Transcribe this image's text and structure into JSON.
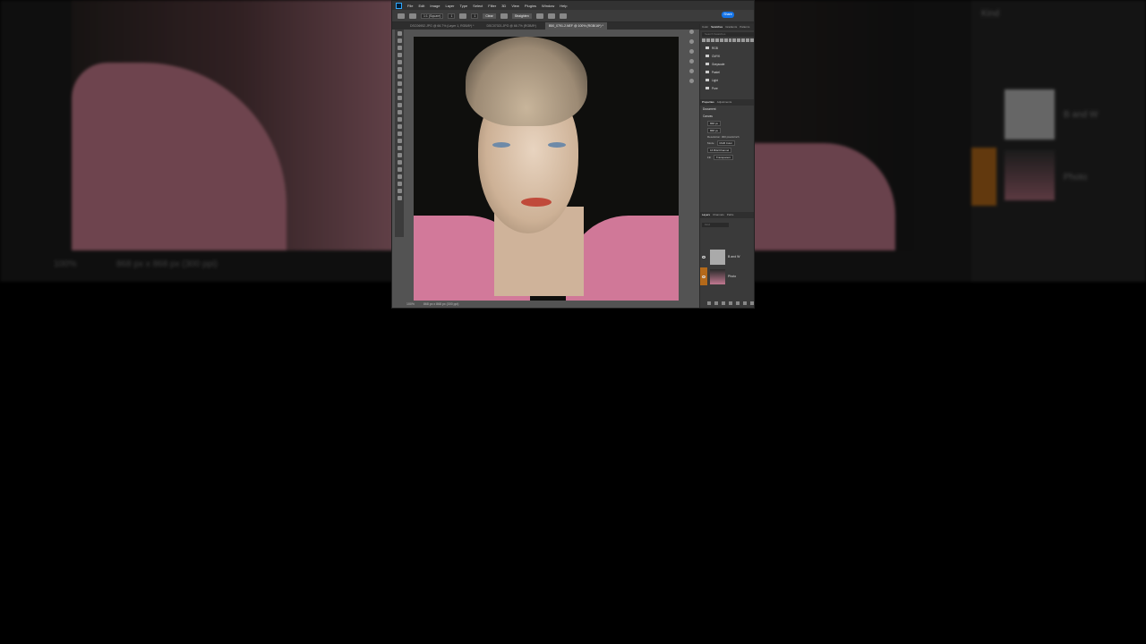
{
  "background": {
    "zoom_text": "100%",
    "doc_size_text": "868 px x 868 px (300 ppi)",
    "kind_label": "Kind",
    "layer_1": "B and W",
    "layer_2": "Photo"
  },
  "menubar": {
    "items": [
      "File",
      "Edit",
      "Image",
      "Layer",
      "Type",
      "Select",
      "Filter",
      "3D",
      "View",
      "Plugins",
      "Window",
      "Help"
    ]
  },
  "optionsbar": {
    "ratio": "1:1 (Square)",
    "w_value": "1",
    "h_value": "1",
    "clear_label": "Clear",
    "straighten_label": "Straighten",
    "share_label": "Share"
  },
  "tabs": [
    {
      "label": "DSC06952.JPG @ 66.7% (Layer 1, RGB/8*) *",
      "active": false
    },
    {
      "label": "DSC07021.JPG @ 66.7% (RGB/8*)",
      "active": false
    },
    {
      "label": "B50_0791-2.NEF @ 100% (RGB/16*) *",
      "active": true
    }
  ],
  "statusbar": {
    "zoom": "100%",
    "doc_size": "868 px x 868 px (300 ppi)"
  },
  "panel": {
    "tabs": [
      "Color",
      "Swatches",
      "Gradients",
      "Patterns"
    ],
    "active_tab": "Swatches",
    "search_placeholder": "Search Swatches",
    "folders": [
      "RGB",
      "CMYK",
      "Grayscale",
      "Pastel",
      "Light",
      "Pure"
    ],
    "properties_tabs": [
      "Properties",
      "Adjustments"
    ],
    "document_label": "Document",
    "canvas_label": "Canvas",
    "width_value": "868 px",
    "height_value": "868 px",
    "resolution_text": "Resolution: 300 pixels/inch",
    "mode_label": "Mode",
    "mode_value": "RGB Color",
    "bits_value": "16 Bits/Channel",
    "fill_label": "Fill",
    "fill_value": "Transparent",
    "layers_tabs": [
      "Layers",
      "Channels",
      "Paths"
    ],
    "kind_label": "Kind",
    "layers": [
      {
        "name": "B and W"
      },
      {
        "name": "Photo"
      }
    ]
  }
}
